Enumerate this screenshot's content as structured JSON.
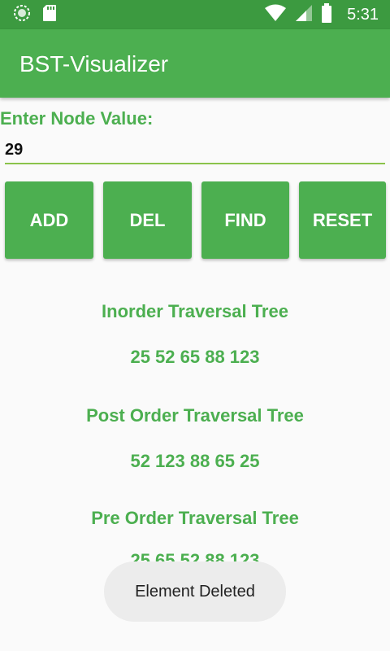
{
  "status_bar": {
    "time": "5:31",
    "left_icons": [
      "sync-icon",
      "sd-card-icon"
    ],
    "right_icons": [
      "wifi-icon",
      "cell-signal-icon",
      "battery-icon"
    ]
  },
  "app_bar": {
    "title": "BST-Visualizer"
  },
  "input": {
    "label": "Enter Node Value:",
    "value": "29"
  },
  "buttons": {
    "add": "ADD",
    "del": "DEL",
    "find": "FIND",
    "reset": "RESET"
  },
  "traversals": {
    "inorder": {
      "title": "Inorder Traversal Tree",
      "values": "25 52 65 88 123"
    },
    "postorder": {
      "title": "Post Order Traversal Tree",
      "values": "52 123 88 65 25"
    },
    "preorder": {
      "title": "Pre Order Traversal Tree",
      "values": "25 65 52 88 123"
    }
  },
  "toast": {
    "message": "Element Deleted"
  },
  "colors": {
    "primary": "#4caf50",
    "primary_dark": "#3c9a40",
    "accent": "#8bc34a",
    "background": "#fafafa"
  }
}
